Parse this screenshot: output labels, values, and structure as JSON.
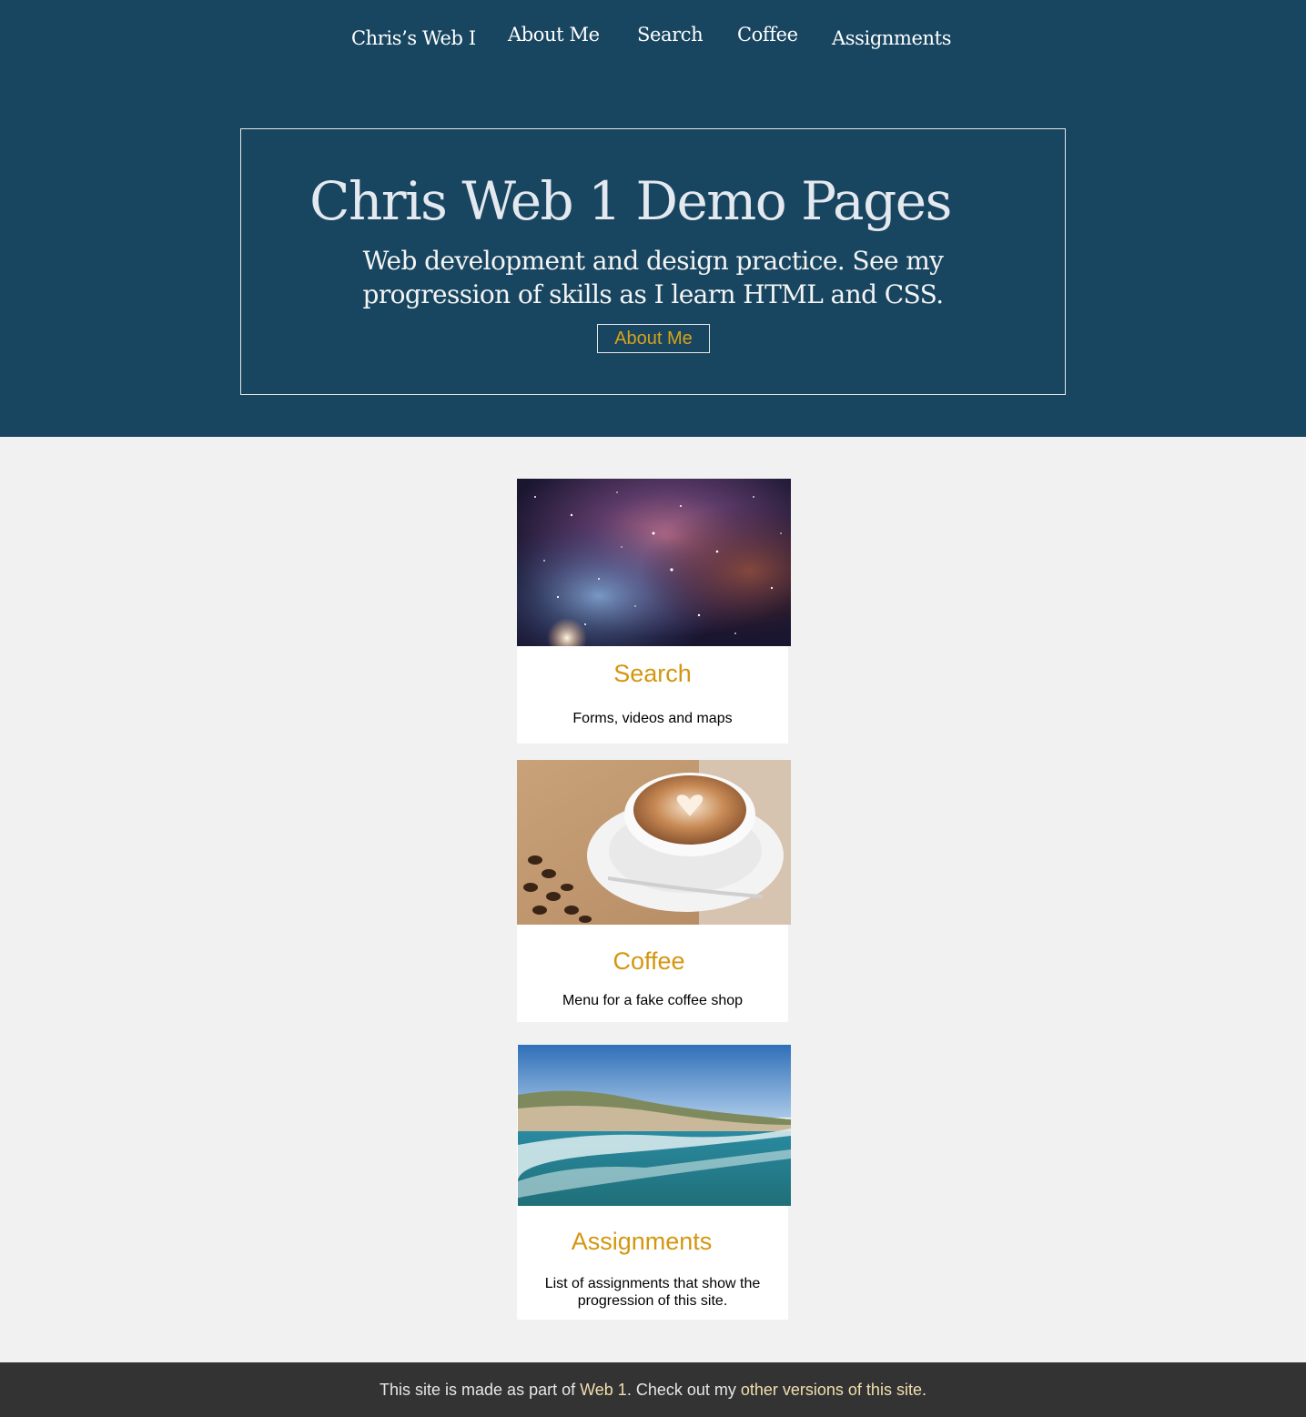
{
  "colors": {
    "header_bg": "#184660",
    "page_bg": "#f1f1f1",
    "accent": "#d4960f",
    "footer_bg": "#333333",
    "footer_link": "#f2dfae"
  },
  "nav": {
    "brand": "Chris’s Web I",
    "items": [
      "About Me",
      "Search",
      "Coffee",
      "Assignments"
    ]
  },
  "hero": {
    "title": "Chris Web 1 Demo Pages",
    "subtitle": "Web development and design practice. See my progression of skills as I learn HTML and CSS.",
    "button_label": "About Me"
  },
  "cards": [
    {
      "title": "Search",
      "description": "Forms, videos and maps",
      "image": "nebula-photo"
    },
    {
      "title": "Coffee",
      "description": "Menu for a fake coffee shop",
      "image": "latte-photo"
    },
    {
      "title": "Assignments",
      "description": "List of assignments that show the progression of this site.",
      "image": "beach-photo"
    }
  ],
  "footer": {
    "prefix": "This site is made as part of ",
    "link1": "Web 1",
    "middle": ". Check out my ",
    "link2": "other versions of this site",
    "suffix": "."
  }
}
